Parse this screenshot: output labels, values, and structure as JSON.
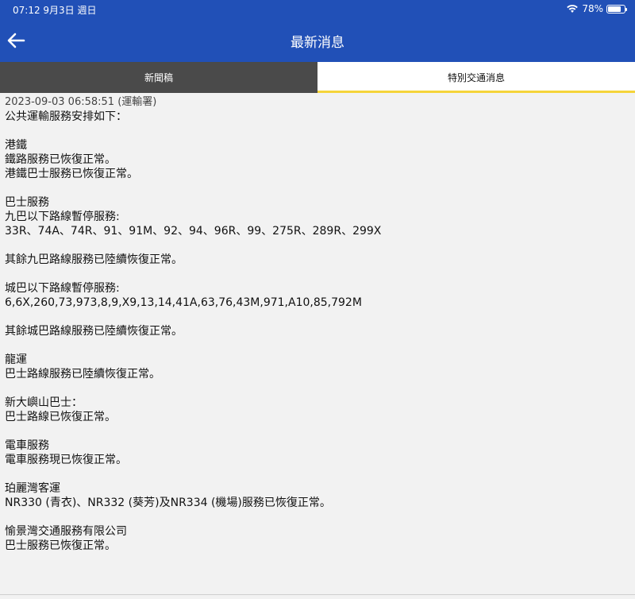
{
  "status_bar": {
    "time_date": "07:12   9月3日 週日",
    "battery_percent": "78%",
    "battery_level": 0.78
  },
  "app_bar": {
    "title": "最新消息",
    "back_icon": "arrow-left-icon"
  },
  "tabs": [
    {
      "label": "新聞稿",
      "selected": false
    },
    {
      "label": "特別交通消息",
      "selected": true
    }
  ],
  "colors": {
    "header": "#2150b7",
    "tab_inactive": "#4a4a4a",
    "tab_indicator": "#f5d43a",
    "content_bg": "#f2f2f2"
  },
  "message": {
    "meta": "2023-09-03 06:58:51 (運輸署)",
    "lines": [
      "公共運輸服務安排如下：",
      "",
      "港鐵",
      "鐵路服務已恢復正常。",
      "港鐵巴士服務已恢復正常。",
      "",
      "巴士服務",
      "九巴以下路線暫停服務:",
      "33R、74A、74R、91、91M、92、94、96R、99、275R、289R、299X",
      "",
      "其餘九巴路線服務已陸續恢復正常。",
      "",
      "城巴以下路線暫停服務:",
      "6,6X,260,73,973,8,9,X9,13,14,41A,63,76,43M,971,A10,85,792M",
      "",
      "其餘城巴路線服務已陸續恢復正常。",
      "",
      "龍運",
      "巴士路線服務已陸續恢復正常。",
      "",
      "新大嶼山巴士：",
      "巴士路線已恢復正常。",
      "",
      "電車服務",
      "電車服務現已恢復正常。",
      "",
      "珀麗灣客運",
      "NR330 (青衣)、NR332 (葵芳)及NR334 (機場)服務已恢復正常。",
      "",
      "愉景灣交通服務有限公司",
      "巴士服務已恢復正常。"
    ]
  }
}
